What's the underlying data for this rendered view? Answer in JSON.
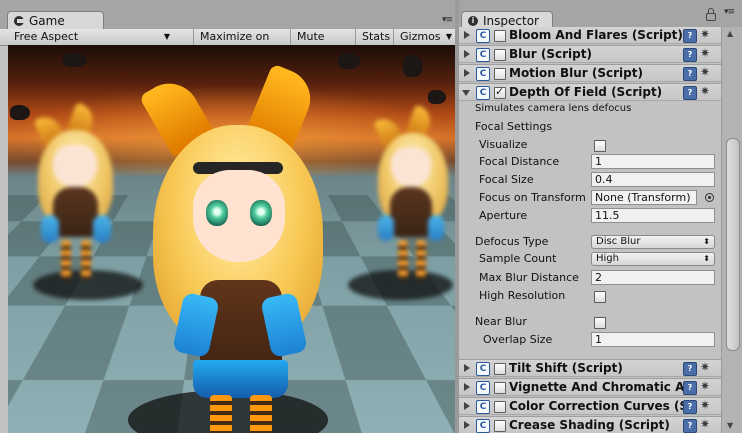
{
  "game": {
    "tab_label": "Game",
    "aspect": "Free Aspect",
    "maximize_label": "Maximize on Play",
    "mute_label": "Mute audio",
    "stats_label": "Stats",
    "gizmos_label": "Gizmos"
  },
  "inspector": {
    "tab_label": "Inspector",
    "components_top": [
      {
        "title": "Bloom And Flares (Script)",
        "enabled": false
      },
      {
        "title": "Blur (Script)",
        "enabled": false
      },
      {
        "title": "Motion Blur (Script)",
        "enabled": false
      }
    ],
    "dof": {
      "title": "Depth Of Field (Script)",
      "enabled": true,
      "description": "Simulates camera lens defocus",
      "focal_settings_label": "Focal Settings",
      "visualize_label": "Visualize",
      "visualize": false,
      "focal_distance_label": "Focal Distance",
      "focal_distance": "1",
      "focal_size_label": "Focal Size",
      "focal_size": "0.4",
      "focus_on_transform_label": "Focus on Transform",
      "focus_on_transform": "None (Transform)",
      "aperture_label": "Aperture",
      "aperture": "11.5",
      "defocus_type_label": "Defocus Type",
      "defocus_type": "Disc Blur",
      "sample_count_label": "Sample Count",
      "sample_count": "High",
      "max_blur_distance_label": "Max Blur Distance",
      "max_blur_distance": "2",
      "high_resolution_label": "High Resolution",
      "high_resolution": false,
      "near_blur_label": "Near Blur",
      "near_blur": false,
      "overlap_size_label": "Overlap Size",
      "overlap_size": "1"
    },
    "components_bottom": [
      {
        "title": "Tilt Shift (Script)",
        "enabled": false
      },
      {
        "title": "Vignette And Chromatic Ab",
        "enabled": false
      },
      {
        "title": "Color Correction Curves (S",
        "enabled": false
      },
      {
        "title": "Crease Shading (Script)",
        "enabled": false
      }
    ]
  }
}
